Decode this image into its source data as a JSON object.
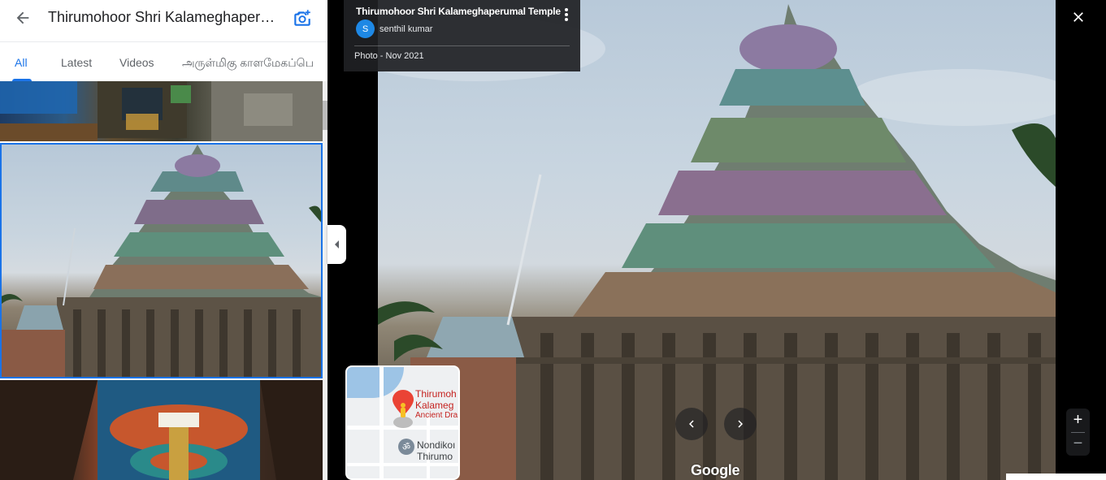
{
  "left_panel": {
    "title": "Thirumohoor Shri Kalameghaper…",
    "tabs": [
      {
        "label": "All"
      },
      {
        "label": "Latest"
      },
      {
        "label": "Videos"
      },
      {
        "label": "அருள்மிகு காளமேகப்பெ"
      }
    ],
    "active_tab": "All"
  },
  "info_card": {
    "title": "Thirumohoor Shri Kalameghaperumal Temple",
    "author_initial": "S",
    "author_name": "senthil kumar",
    "photo_date": "Photo - Nov 2021"
  },
  "viewer": {
    "watermark": "Google",
    "zoom_in_label": "+",
    "zoom_out_label": "−"
  },
  "mini_map": {
    "place_name_line1": "Thirumoh",
    "place_name_line2": "Kalameg",
    "place_category": "Ancient Dra",
    "poi_icon_glyph": "ॐ",
    "poi_line1": "Nondikoı",
    "poi_line2": "Thirumo"
  },
  "colors": {
    "accent": "#1a73e8",
    "info_card_bg": "#202124",
    "avatar": "#1e88e5",
    "map_pin": "#ea4335"
  },
  "icons": {
    "back": "arrow-left-icon",
    "add_photo": "add-photo-icon",
    "close": "close-icon",
    "more": "more-vertical-icon",
    "prev": "chevron-left-icon",
    "next": "chevron-right-icon",
    "collapse": "collapse-left-icon",
    "map_pin": "map-pin-icon",
    "pegman": "street-view-icon"
  }
}
